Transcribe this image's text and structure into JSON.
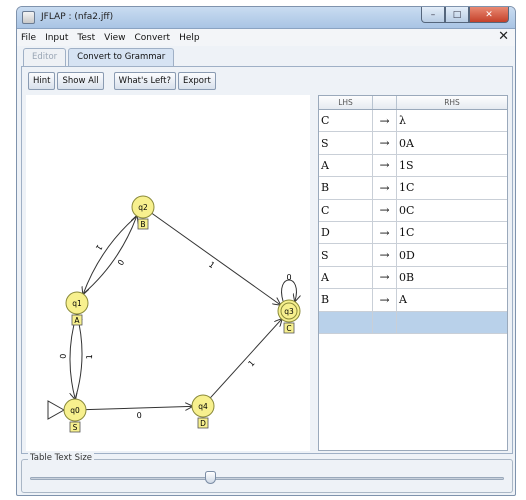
{
  "window": {
    "title": "JFLAP : (nfa2.jff)",
    "controls": {
      "minimize": "–",
      "maximize": "□",
      "close": "✕"
    }
  },
  "menu": [
    "File",
    "Input",
    "Test",
    "View",
    "Convert",
    "Help"
  ],
  "close_x": "✕",
  "tabs": [
    {
      "label": "Editor",
      "active": false
    },
    {
      "label": "Convert to Grammar",
      "active": true
    }
  ],
  "toolbar": [
    "Hint",
    "Show All",
    "What's Left?",
    "Export"
  ],
  "automaton": {
    "states": [
      {
        "id": "q0",
        "label": "q0",
        "tag": "S",
        "initial": true,
        "final": false
      },
      {
        "id": "q1",
        "label": "q1",
        "tag": "A",
        "initial": false,
        "final": false
      },
      {
        "id": "q2",
        "label": "q2",
        "tag": "B",
        "initial": false,
        "final": false
      },
      {
        "id": "q3",
        "label": "q3",
        "tag": "C",
        "initial": false,
        "final": true
      },
      {
        "id": "q4",
        "label": "q4",
        "tag": "D",
        "initial": false,
        "final": false
      }
    ],
    "transitions": [
      {
        "from": "q1",
        "to": "q2",
        "label": "0"
      },
      {
        "from": "q2",
        "to": "q1",
        "label": "1"
      },
      {
        "from": "q1",
        "to": "q0",
        "label": "0"
      },
      {
        "from": "q0",
        "to": "q1",
        "label": "1"
      },
      {
        "from": "q0",
        "to": "q4",
        "label": "0"
      },
      {
        "from": "q4",
        "to": "q3",
        "label": "1"
      },
      {
        "from": "q2",
        "to": "q3",
        "label": "1"
      },
      {
        "from": "q3",
        "to": "q3",
        "label": "0"
      }
    ]
  },
  "grammar": {
    "headers": {
      "lhs": "LHS",
      "arrow": "",
      "rhs": "RHS"
    },
    "arrow": "→",
    "rows": [
      {
        "lhs": "C",
        "rhs": "λ"
      },
      {
        "lhs": "S",
        "rhs": "0A"
      },
      {
        "lhs": "A",
        "rhs": "1S"
      },
      {
        "lhs": "B",
        "rhs": "1C"
      },
      {
        "lhs": "C",
        "rhs": "0C"
      },
      {
        "lhs": "D",
        "rhs": "1C"
      },
      {
        "lhs": "S",
        "rhs": "0D"
      },
      {
        "lhs": "A",
        "rhs": "0B"
      },
      {
        "lhs": "B",
        "rhs": "A"
      },
      {
        "lhs": "",
        "rhs": "",
        "selected": true
      }
    ]
  },
  "table_text_size": {
    "label": "Table Text Size",
    "value": 0.38
  },
  "colors": {
    "state_fill": "#f7f08e",
    "state_stroke": "#8a8a3a",
    "selected_row": "#b9d1ea",
    "title_bar": "#b7cfea",
    "close_button": "#c9432e"
  }
}
